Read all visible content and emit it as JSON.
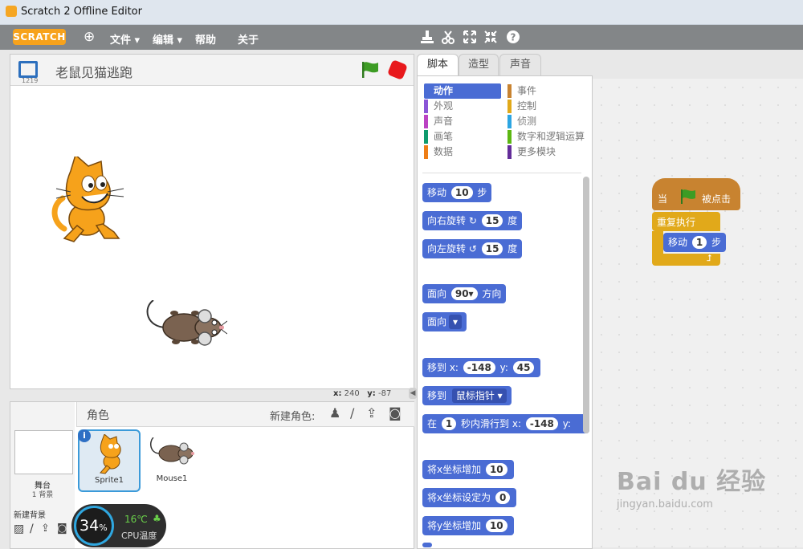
{
  "window": {
    "title": "Scratch 2 Offline Editor"
  },
  "menubar": {
    "logo": "SCRATCH",
    "items": [
      "文件 ▾",
      "编辑 ▾",
      "帮助",
      "关于"
    ]
  },
  "stage": {
    "title": "老鼠见猫逃跑",
    "version_badge": "1219",
    "coords": {
      "x_label": "x:",
      "x": "240",
      "y_label": "y:",
      "y": "-87"
    }
  },
  "sprites_pane": {
    "header_label": "角色",
    "new_sprite_label": "新建角色:",
    "stage_label": "舞台",
    "stage_backdrops": "1 背景",
    "new_backdrop_label": "新建背景",
    "sprites": [
      {
        "name": "Sprite1",
        "selected": true
      },
      {
        "name": "Mouse1",
        "selected": false
      }
    ]
  },
  "tabs": [
    "脚本",
    "造型",
    "声音"
  ],
  "categories": {
    "left": [
      {
        "label": "动作",
        "color": "#4a6cd4",
        "active": true
      },
      {
        "label": "外观",
        "color": "#8a55d7"
      },
      {
        "label": "声音",
        "color": "#bb42c3"
      },
      {
        "label": "画笔",
        "color": "#0e9a6c"
      },
      {
        "label": "数据",
        "color": "#ee7d16"
      }
    ],
    "right": [
      {
        "label": "事件",
        "color": "#c88330"
      },
      {
        "label": "控制",
        "color": "#e1a91a"
      },
      {
        "label": "侦测",
        "color": "#2ca5e2"
      },
      {
        "label": "数字和逻辑运算",
        "color": "#5cb712"
      },
      {
        "label": "更多模块",
        "color": "#632d99"
      }
    ]
  },
  "palette_blocks": {
    "move": {
      "pre": "移动",
      "num": "10",
      "post": "步"
    },
    "turn_right": {
      "pre": "向右旋转",
      "icon": "↻",
      "num": "15",
      "post": "度"
    },
    "turn_left": {
      "pre": "向左旋转",
      "icon": "↺",
      "num": "15",
      "post": "度"
    },
    "point_dir": {
      "pre": "面向",
      "num": "90▾",
      "post": "方向"
    },
    "point_towards": {
      "pre": "面向",
      "dd": "▾"
    },
    "goto_xy": {
      "pre": "移到 x:",
      "x": "-148",
      "mid": "y:",
      "y": "45"
    },
    "goto": {
      "pre": "移到",
      "dd": "鼠标指针 ▾"
    },
    "glide": {
      "pre": "在",
      "secs": "1",
      "mid": "秒内滑行到 x:",
      "x": "-148",
      "post": "y:"
    },
    "change_x": {
      "pre": "将x坐标增加",
      "num": "10"
    },
    "set_x": {
      "pre": "将x坐标设定为",
      "num": "0"
    },
    "change_y": {
      "pre": "将y坐标增加",
      "num": "10"
    }
  },
  "script": {
    "hat": {
      "pre": "当",
      "post": "被点击"
    },
    "forever": "重复执行",
    "move": {
      "pre": "移动",
      "num": "1",
      "post": "步"
    }
  },
  "cpu_widget": {
    "percent": "34",
    "percent_unit": "%",
    "temp": "16℃",
    "label": "CPU温度"
  },
  "watermark": {
    "logo": "Bai du 经验",
    "url": "jingyan.baidu.com"
  }
}
